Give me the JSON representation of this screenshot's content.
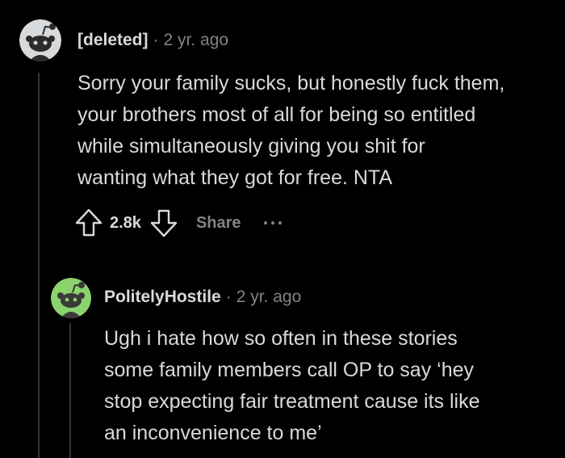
{
  "colors": {
    "background": "#000000",
    "text": "#d7dadc",
    "meta": "#818384",
    "thread_line": "#343536",
    "deleted_avatar_bg": "#d7dadc",
    "polite_avatar_bg": "#8bd36b"
  },
  "comments": [
    {
      "author": "[deleted]",
      "separator": "·",
      "time": "2 yr. ago",
      "avatar_icon": "snoo-deleted-icon",
      "body_lines": [
        "Sorry your family sucks, but honestly fuck them,",
        "your brothers most of all for being so entitled",
        "while simultaneously giving you shit for",
        "wanting what they got for free. NTA"
      ],
      "score": "2.8k",
      "share_label": "Share",
      "upvote_icon": "upvote-arrow-icon",
      "downvote_icon": "downvote-arrow-icon",
      "more_icon": "more-dots-icon"
    },
    {
      "author": "PolitelyHostile",
      "separator": "·",
      "time": "2 yr. ago",
      "avatar_icon": "snoo-green-icon",
      "body_lines": [
        "Ugh i hate how so often in these stories",
        "some family members call OP to say ‘hey",
        "stop expecting fair treatment cause its like",
        "an inconvenience to me’"
      ]
    }
  ]
}
